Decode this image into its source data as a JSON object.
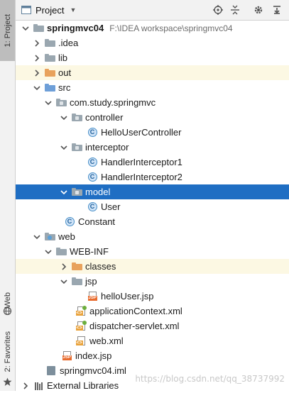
{
  "toolstrip": {
    "project_tab": "1: Project",
    "web_tab": "Web",
    "favorites_tab": "2: Favorites"
  },
  "header": {
    "title": "Project",
    "buttons": [
      "target-icon",
      "collapse-icon",
      "gear-icon",
      "hide-icon"
    ]
  },
  "tree": {
    "root": {
      "name": "springmvc04",
      "path": "F:\\IDEA workspace\\springmvc04"
    },
    "idea": ".idea",
    "lib": "lib",
    "out": "out",
    "src": "src",
    "package": "com.study.springmvc",
    "controller": "controller",
    "hello_controller": "HelloUserController",
    "interceptor": "interceptor",
    "handler1": "HandlerInterceptor1",
    "handler2": "HandlerInterceptor2",
    "model": "model",
    "user": "User",
    "constant": "Constant",
    "web": "web",
    "webinf": "WEB-INF",
    "classes": "classes",
    "jsp": "jsp",
    "hello_jsp": "helloUser.jsp",
    "app_context": "applicationContext.xml",
    "dispatcher": "dispatcher-servlet.xml",
    "web_xml": "web.xml",
    "index_jsp": "index.jsp",
    "iml": "springmvc04.iml",
    "external_libs": "External Libraries"
  },
  "class_icon_letter": "C",
  "jsp_tag": "JSP",
  "xml_tag": "<>",
  "watermark": "https://blog.csdn.net/qq_38737992",
  "colors": {
    "selection": "#1f6ec3",
    "highlight_row": "#fcf8e3",
    "folder_gray": "#9aa7b0",
    "folder_orange": "#e8a25c",
    "folder_blue": "#6e9fd8"
  }
}
